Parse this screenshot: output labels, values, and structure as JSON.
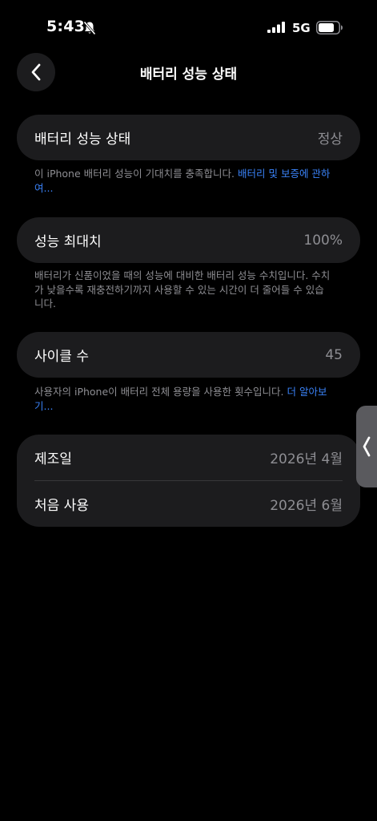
{
  "status_bar": {
    "time": "5:43",
    "network": "5G",
    "icons": [
      "bell-slash-icon",
      "cellular-signal-icon",
      "battery-icon"
    ]
  },
  "header": {
    "title": "배터리 성능 상태",
    "back_icon": "chevron-left-icon"
  },
  "sections": {
    "health": {
      "label": "배터리 성능 상태",
      "value": "정상",
      "note": "이 iPhone 배터리 성능이 기대치를 충족합니다. ",
      "link": "배터리 및 보증에 관하여..."
    },
    "max_capacity": {
      "label": "성능 최대치",
      "value": "100%",
      "note": "배터리가 신품이었을 때의 성능에 대비한 배터리 성능 수치입니다. 수치가 낮을수록 재충전하기까지 사용할 수 있는 시간이 더 줄어들 수 있습니다."
    },
    "cycle_count": {
      "label": "사이클 수",
      "value": "45",
      "note": "사용자의 iPhone이 배터리 전체 용량을 사용한 횟수입니다. ",
      "link": "더 알아보기..."
    },
    "dates": {
      "manufacture_label": "제조일",
      "manufacture_value": "2026년 4월",
      "first_use_label": "처음 사용",
      "first_use_value": "2026년 6월"
    }
  },
  "colors": {
    "background": "#000000",
    "card": "#1c1c1e",
    "secondary_text": "#8e8e93",
    "link": "#3a82f7"
  }
}
